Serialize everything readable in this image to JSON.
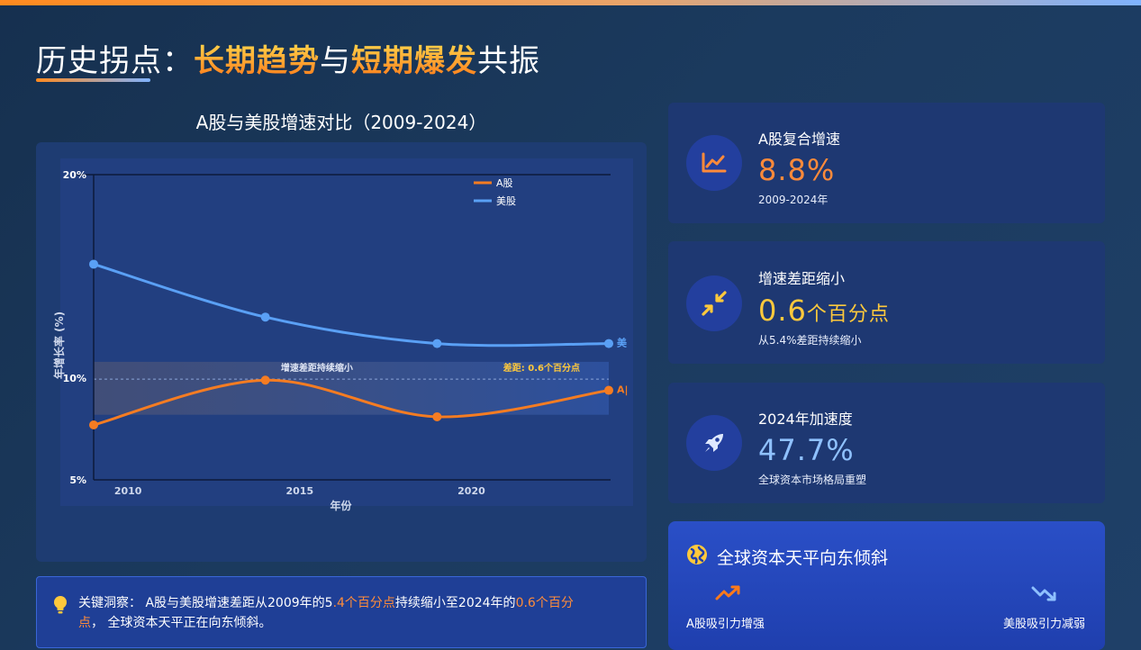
{
  "header": {
    "title_part1": "历史拐点：",
    "title_hl1": "长期趋势",
    "title_part2": "与",
    "title_hl2": "短期爆发",
    "title_part3": "共振"
  },
  "colors": {
    "accent_orange": "#ff7a1a",
    "accent_yellow": "#ffc93c",
    "a_share": "#f57c22",
    "us_share": "#5aa0f5",
    "card_value_orange": "#ff8a3a",
    "card_value_yellow": "#ffc93c",
    "card_value_blue": "#8fc1ff"
  },
  "chart_data": {
    "type": "line",
    "title": "A股与美股增速对比（2009-2024）",
    "xlabel": "年份",
    "ylabel": "年增长率 (%)",
    "x": [
      2009,
      2014,
      2019,
      2024
    ],
    "x_ticks": [
      "2010",
      "2015",
      "2020"
    ],
    "y_ticks": [
      "5%",
      "10%",
      "20%"
    ],
    "ylim": [
      5,
      20
    ],
    "grid": false,
    "legend_position": "top-right",
    "series": [
      {
        "name": "A股",
        "color": "#f57c22",
        "values": [
          7.7,
          9.9,
          8.1,
          9.4
        ],
        "end_label": "A|"
      },
      {
        "name": "美股",
        "color": "#5aa0f5",
        "values": [
          15.6,
          13.0,
          11.7,
          11.7
        ],
        "end_label": "美"
      }
    ],
    "band": {
      "y_range": [
        8.2,
        10.8
      ],
      "label": "增速差距持续缩小"
    },
    "annotation": "差距: 0.6个百分点"
  },
  "cards": [
    {
      "label": "A股复合增速",
      "value": "8.8%",
      "unit": "",
      "sub": "2009-2024年",
      "icon": "line-chart-icon"
    },
    {
      "label": "增速差距缩小",
      "value": "0.6",
      "unit": "个百分点",
      "sub": "从5.4%差距持续缩小",
      "icon": "compress-arrows-icon"
    },
    {
      "label": "2024年加速度",
      "value": "47.7%",
      "unit": "",
      "sub": "全球资本市场格局重塑",
      "icon": "rocket-icon"
    }
  ],
  "bottom_card": {
    "title": "全球资本天平向东倾斜",
    "left_label": "A股吸引力增强",
    "right_label": "美股吸引力减弱"
  },
  "insight": {
    "prefix": "关键洞察：  A股与美股增速差距从2009年的5",
    "hl1": ".4个百分点",
    "middle": "持续缩小至2024年的",
    "hl2": "0.6个百分",
    "hl3": "点",
    "suffix": "，  全球资本天平正在向东倾斜。"
  }
}
